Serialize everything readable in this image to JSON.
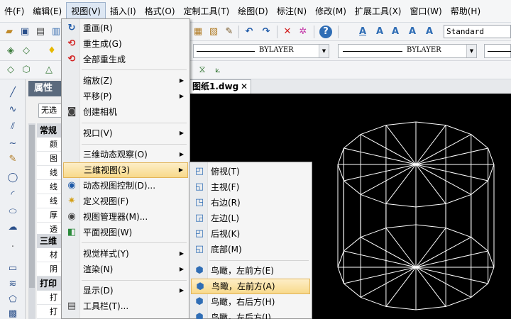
{
  "menubar": {
    "items": [
      "件(F)",
      "编辑(E)",
      "视图(V)",
      "插入(I)",
      "格式(O)",
      "定制工具(T)",
      "绘图(D)",
      "标注(N)",
      "修改(M)",
      "扩展工具(X)",
      "窗口(W)",
      "帮助(H)"
    ],
    "active_index": 2
  },
  "toolbar": {
    "text_style": "Standard",
    "linetype": "BYLAYER",
    "lineweight": "BYLAYER"
  },
  "properties": {
    "title": "属性",
    "selection": "无选",
    "sections": [
      "常规",
      "三维",
      "打印"
    ],
    "rows": [
      "颜",
      "图",
      "线",
      "线",
      "线",
      "厚",
      "透",
      "材",
      "阴",
      "打",
      "打"
    ]
  },
  "document": {
    "tab_label": "图纸1.dwg",
    "close_glyph": "✕"
  },
  "view_menu": {
    "items": [
      {
        "label": "重画(R)",
        "icon": "redraw-icon"
      },
      {
        "label": "重生成(G)",
        "icon": "regen-icon"
      },
      {
        "label": "全部重生成",
        "icon": "regen-all-icon"
      },
      {
        "label": "缩放(Z)",
        "icon": "",
        "submenu": true
      },
      {
        "label": "平移(P)",
        "icon": "",
        "submenu": true
      },
      {
        "label": "创建相机",
        "icon": "camera-icon"
      },
      {
        "label": "视口(V)",
        "icon": "",
        "submenu": true
      },
      {
        "label": "三维动态观察(O)",
        "icon": "",
        "submenu": true
      },
      {
        "label": "三维视图(3)",
        "icon": "",
        "submenu": true
      },
      {
        "label": "动态视图控制(D)...",
        "icon": "eye-icon"
      },
      {
        "label": "定义视图(F)",
        "icon": "camera-star-icon"
      },
      {
        "label": "视图管理器(M)...",
        "icon": "eye-icon"
      },
      {
        "label": "平面视图(W)",
        "icon": "plan-view-icon"
      },
      {
        "label": "视觉样式(Y)",
        "icon": "",
        "submenu": true
      },
      {
        "label": "渲染(N)",
        "icon": "",
        "submenu": true
      },
      {
        "label": "显示(D)",
        "icon": "",
        "submenu": true
      },
      {
        "label": "工具栏(T)...",
        "icon": "toolbar-icon"
      }
    ],
    "highlighted": "三维视图(3)"
  },
  "view3d_submenu": {
    "items": [
      {
        "label": "俯视(T)",
        "icon": "top-view-icon"
      },
      {
        "label": "主视(F)",
        "icon": "front-view-icon"
      },
      {
        "label": "右边(R)",
        "icon": "right-view-icon"
      },
      {
        "label": "左边(L)",
        "icon": "left-view-icon"
      },
      {
        "label": "后视(K)",
        "icon": "back-view-icon"
      },
      {
        "label": "底部(M)",
        "icon": "bottom-view-icon"
      },
      {
        "label": "鸟瞰，左前方(E)",
        "icon": "iso-cube-icon"
      },
      {
        "label": "鸟瞰，左前方(A)",
        "icon": "iso-cube-icon"
      },
      {
        "label": "鸟瞰，右后方(H)",
        "icon": "iso-cube-icon"
      },
      {
        "label": "鸟瞰，左后方(I)",
        "icon": "iso-cube-icon"
      }
    ],
    "highlighted": "鸟瞰，左前方(A)"
  }
}
